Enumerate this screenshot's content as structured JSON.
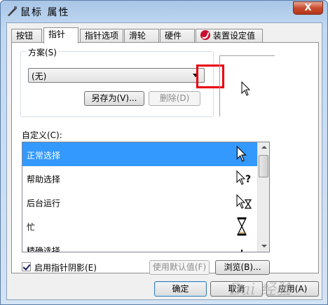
{
  "window": {
    "title": "鼠标 属性",
    "close_label": "X"
  },
  "tabs": [
    {
      "label": "按钮"
    },
    {
      "label": "指针"
    },
    {
      "label": "指针选项"
    },
    {
      "label": "滑轮"
    },
    {
      "label": "硬件"
    },
    {
      "label": "装置设定值"
    }
  ],
  "scheme": {
    "label": "方案(S)",
    "selected": "(无)",
    "save_as_label": "另存为(V)...",
    "delete_label": "删除(D)"
  },
  "customize": {
    "label": "自定义(C):",
    "items": [
      {
        "label": "正常选择",
        "cursor": "arrow-cursor-icon"
      },
      {
        "label": "帮助选择",
        "cursor": "help-cursor-icon"
      },
      {
        "label": "后台运行",
        "cursor": "working-cursor-icon"
      },
      {
        "label": "忙",
        "cursor": "busy-cursor-icon"
      },
      {
        "label": "精确选择",
        "cursor": "precision-cursor-icon"
      }
    ]
  },
  "options": {
    "shadow_label": "启用指针阴影(E)",
    "shadow_checked": true,
    "use_default_label": "使用默认值(F)",
    "browse_label": "浏览(B)..."
  },
  "footer": {
    "ok_label": "确定",
    "cancel_label": "取消",
    "apply_label": "应用(A)"
  },
  "watermark": "Bai 经验",
  "colors": {
    "selection": "#3399ff",
    "highlight_box": "#e8000b",
    "close_button": "#c94a2e"
  }
}
